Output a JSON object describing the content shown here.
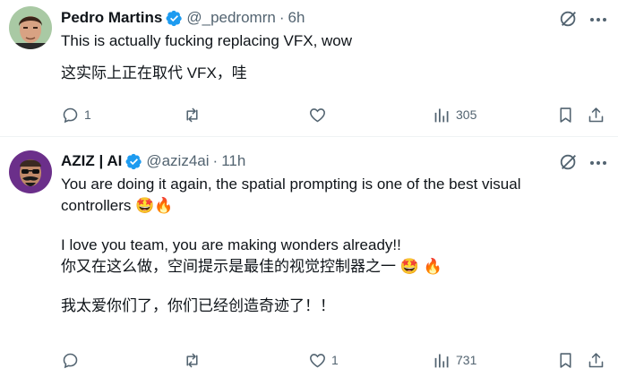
{
  "tweets": [
    {
      "name": "Pedro Martins",
      "handle": "@_pedromrn",
      "dot": "·",
      "time": "6h",
      "lines": [
        "This is actually fucking replacing VFX, wow",
        "这实际上正在取代 VFX，哇"
      ],
      "reply_count": "1",
      "retweet_count": "",
      "like_count": "",
      "views_count": "305"
    },
    {
      "name": "AZIZ | AI",
      "handle": "@aziz4ai",
      "dot": "·",
      "time": "11h",
      "line1": "You are doing it again, the spatial prompting is one of the best visual",
      "line2": "controllers",
      "line2_emojis": "🤩🔥",
      "line3": "I love you team, you are making wonders already!!",
      "line4": "你又在这么做，空间提示是最佳的视觉控制器之一",
      "line4_emojis": "🤩 🔥",
      "line5": "我太爱你们了，你们已经创造奇迹了！！",
      "reply_count": "",
      "retweet_count": "",
      "like_count": "1",
      "views_count": "731"
    }
  ],
  "colors": {
    "text": "#0f1419",
    "muted": "#536471",
    "verified": "#1d9bf0",
    "divider": "#eff3f4"
  },
  "icons": [
    "verified-badge-icon",
    "grok-icon",
    "more-icon",
    "reply-icon",
    "retweet-icon",
    "like-icon",
    "views-icon",
    "bookmark-icon",
    "share-icon"
  ]
}
